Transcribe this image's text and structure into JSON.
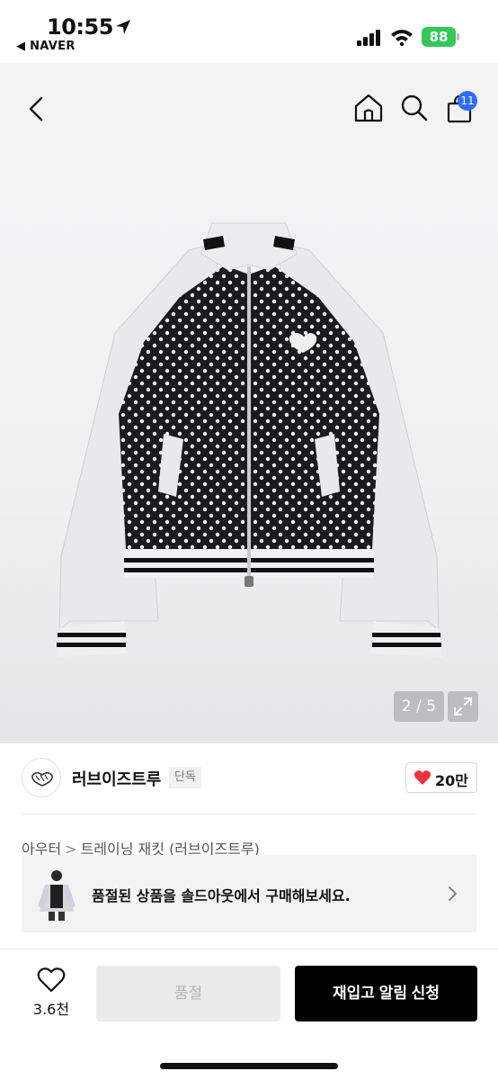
{
  "status_bar": {
    "time": "10:55",
    "back_app": "◀ NAVER",
    "battery": "88",
    "battery_color": "#34c759"
  },
  "nav": {
    "back_icon": "chevron-left-icon",
    "home_icon": "home-icon",
    "search_icon": "search-icon",
    "cart_icon": "shopping-bag-icon",
    "cart_count": "11",
    "badge_color": "#2f6bff"
  },
  "gallery": {
    "page_counter": "2 / 5",
    "expand_icon": "expand-icon"
  },
  "brand": {
    "name": "러브이즈트루",
    "badge": "단독",
    "like_count": "20만",
    "heart_color": "#f2323f"
  },
  "breadcrumb": {
    "category": "아우터",
    "separator": ">",
    "subcategory": "트레이닝 재킷 (러브이즈트루)"
  },
  "soldout_banner": {
    "text": "품절된 상품을 솔드아웃에서 구매해보세요."
  },
  "bottom_bar": {
    "wish_count": "3.6천",
    "soldout_label": "품절",
    "restock_label": "재입고 알림 신청"
  }
}
